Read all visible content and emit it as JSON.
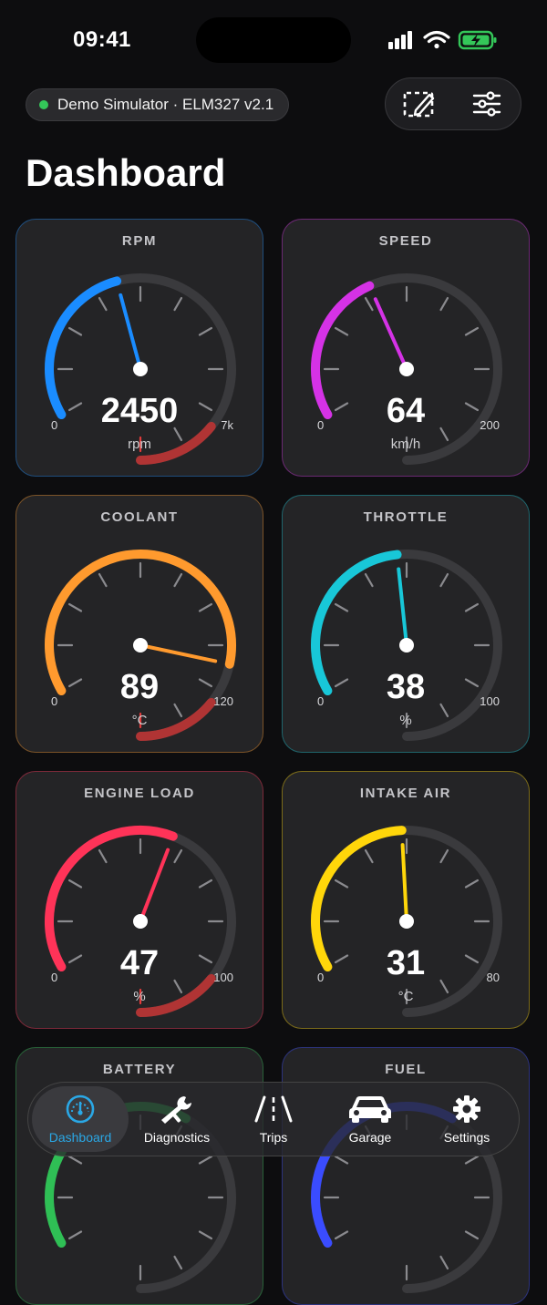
{
  "status": {
    "time": "09:41"
  },
  "connection": {
    "label": "Demo Simulator · ELM327 v2.1",
    "status_color": "#34c759"
  },
  "actions": {
    "layout_icon": "edit-layout-icon",
    "settings_icon": "sliders-icon"
  },
  "title": "Dashboard",
  "gauges": [
    {
      "label": "RPM",
      "value": "2450",
      "unit": "rpm",
      "min": "0",
      "max": "7k",
      "fraction": 0.35,
      "color": "#1a8cff",
      "redline": true
    },
    {
      "label": "SPEED",
      "value": "64",
      "unit": "km/h",
      "min": "0",
      "max": "200",
      "fraction": 0.32,
      "color": "#d532e6",
      "redline": false
    },
    {
      "label": "COOLANT",
      "value": "89",
      "unit": "°C",
      "min": "0",
      "max": "120",
      "fraction": 0.74,
      "color": "#ff9a2e",
      "redline": true
    },
    {
      "label": "THROTTLE",
      "value": "38",
      "unit": "%",
      "min": "0",
      "max": "100",
      "fraction": 0.38,
      "color": "#18c7d8",
      "redline": false
    },
    {
      "label": "ENGINE LOAD",
      "value": "47",
      "unit": "%",
      "min": "0",
      "max": "100",
      "fraction": 0.47,
      "color": "#ff3358",
      "redline": true
    },
    {
      "label": "INTAKE AIR",
      "value": "31",
      "unit": "°C",
      "min": "0",
      "max": "80",
      "fraction": 0.39,
      "color": "#ffd60a",
      "redline": false
    },
    {
      "label": "BATTERY",
      "value": "",
      "unit": "",
      "min": "",
      "max": "",
      "fraction": 0.5,
      "color": "#2fbf55",
      "redline": false
    },
    {
      "label": "FUEL",
      "value": "",
      "unit": "",
      "min": "",
      "max": "",
      "fraction": 0.5,
      "color": "#3a4cff",
      "redline": false
    }
  ],
  "tabs": [
    {
      "label": "Dashboard",
      "icon": "gauge-icon",
      "active": true
    },
    {
      "label": "Diagnostics",
      "icon": "wrench-icon",
      "active": false
    },
    {
      "label": "Trips",
      "icon": "road-icon",
      "active": false
    },
    {
      "label": "Garage",
      "icon": "car-icon",
      "active": false
    },
    {
      "label": "Settings",
      "icon": "gear-icon",
      "active": false
    }
  ],
  "theme": {
    "card_bg": "#242426",
    "track": "#3a3a3d",
    "redline": "#b03434",
    "active_tab": "#2aa8e6"
  }
}
